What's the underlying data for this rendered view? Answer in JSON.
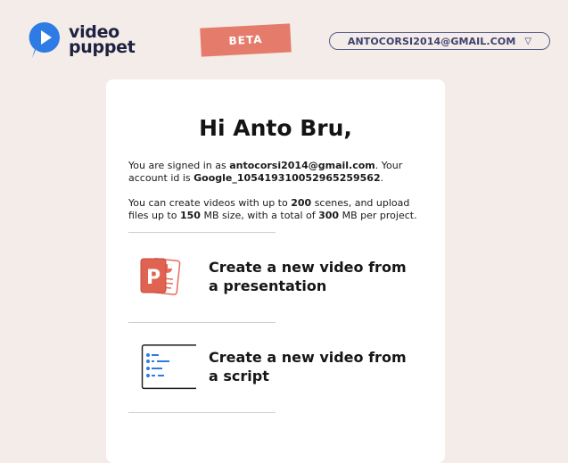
{
  "app": {
    "logo_line1": "video",
    "logo_line2": "puppet",
    "badge": "BETA",
    "account_email": "ANTOCORSI2014@GMAIL.COM",
    "account_caret": "▽"
  },
  "card": {
    "greeting": "Hi Anto Bru,",
    "signed_in_prefix": "You are signed in as ",
    "signed_in_email": "antocorsi2014@gmail.com",
    "signed_in_mid": ". Your account id is ",
    "account_id": "Google_105419310052965259562",
    "signed_in_suffix": ".",
    "limits_1": "You can create videos with up to ",
    "max_scenes": "200",
    "limits_2": " scenes, and upload files up to ",
    "max_file_mb": "150",
    "limits_3": " MB size, with a total of ",
    "max_project_mb": "300",
    "limits_4": " MB per project."
  },
  "actions": [
    {
      "label": "Create a new video from a presentation",
      "icon": "presentation-icon"
    },
    {
      "label": "Create a new video from a script",
      "icon": "script-icon"
    }
  ],
  "colors": {
    "background": "#f3ece8",
    "badge": "#e57c6b",
    "logo_blue": "#2f7be5",
    "account_border": "#575b8a"
  }
}
